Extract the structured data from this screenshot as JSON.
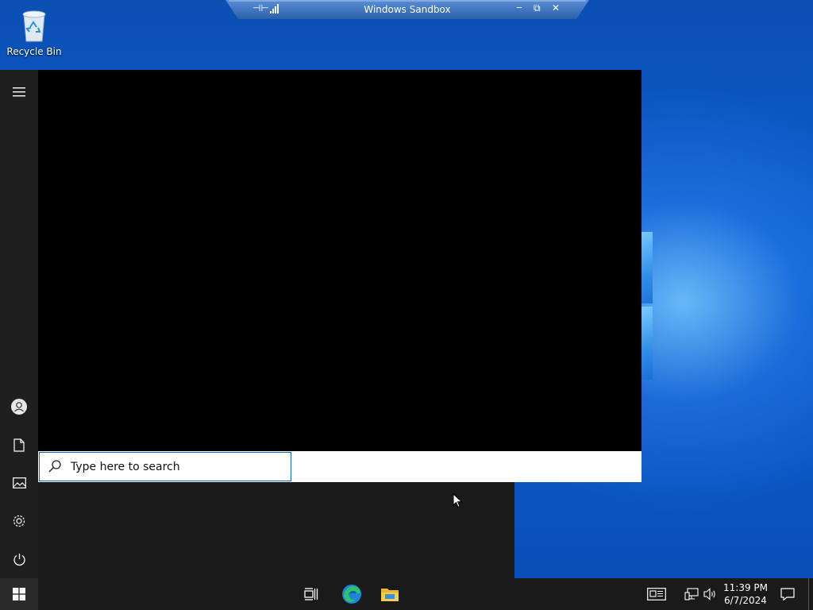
{
  "desktop": {
    "recycle_bin_label": "Recycle Bin"
  },
  "sandbox_bar": {
    "title": "Windows Sandbox"
  },
  "start_menu": {
    "search_placeholder": "Type here to search"
  },
  "taskbar": {
    "time": "11:39 PM",
    "date": "6/7/2024"
  },
  "colors": {
    "accent": "#0a64c8",
    "taskbar": "#1a1a1a",
    "start_rail": "#1f1f1f"
  }
}
